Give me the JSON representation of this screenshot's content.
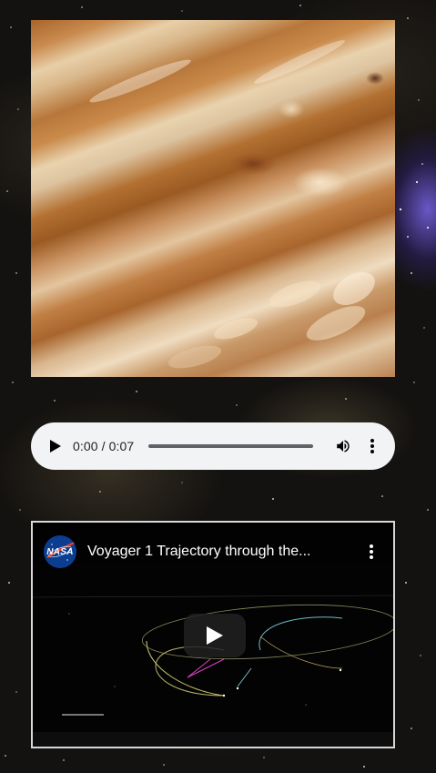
{
  "jupiter_image": {
    "subject": "Jupiter cloud bands close-up"
  },
  "audio": {
    "time_display": "0:00 / 0:07",
    "play_icon": "play-icon",
    "volume_icon": "volume-icon",
    "menu_icon": "more-vertical-icon",
    "progress": 0
  },
  "video": {
    "channel": "NASA",
    "title": "Voyager 1 Trajectory through the...",
    "menu_icon": "more-vertical-icon",
    "play_icon": "youtube-play-icon"
  },
  "colors": {
    "audio_bg": "#f1f3f4",
    "audio_text": "#202124",
    "track": "#5f6368",
    "video_border": "#d8d8d8",
    "nasa_blue": "#0b3d91",
    "nasa_red": "#fc3d21"
  }
}
